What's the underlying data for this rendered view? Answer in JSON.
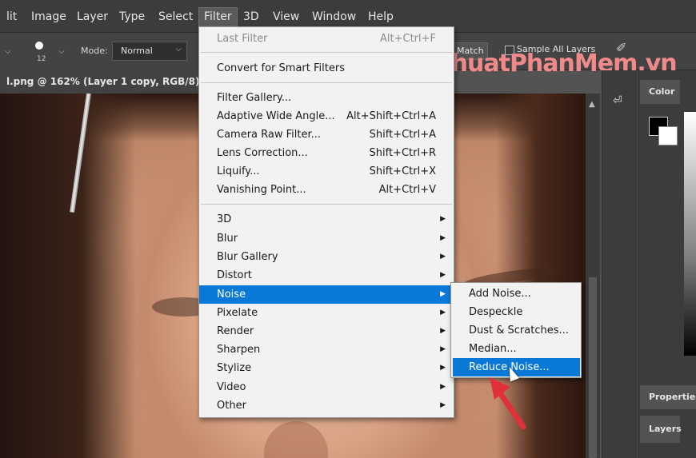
{
  "menubar": {
    "items": [
      "lit",
      "Image",
      "Layer",
      "Type",
      "Select",
      "Filter",
      "3D",
      "View",
      "Window",
      "Help"
    ],
    "active": "Filter"
  },
  "options_bar": {
    "brush_size": "12",
    "mode_label": "Mode:",
    "mode_value": "Normal",
    "match_label": "Match",
    "sample_all_layers_label": "Sample All Layers"
  },
  "document": {
    "tab_title": "l.png @ 162% (Layer 1 copy, RGB/8) *"
  },
  "watermark": "ThuThuatPhanMem.vn",
  "filter_menu": {
    "items": [
      {
        "label": "Last Filter",
        "shortcut": "Alt+Ctrl+F",
        "disabled": true
      },
      {
        "label": "Convert for Smart Filters",
        "shortcut": ""
      },
      {
        "label": "Filter Gallery...",
        "shortcut": ""
      },
      {
        "label": "Adaptive Wide Angle...",
        "shortcut": "Alt+Shift+Ctrl+A"
      },
      {
        "label": "Camera Raw Filter...",
        "shortcut": "Shift+Ctrl+A"
      },
      {
        "label": "Lens Correction...",
        "shortcut": "Shift+Ctrl+R"
      },
      {
        "label": "Liquify...",
        "shortcut": "Shift+Ctrl+X"
      },
      {
        "label": "Vanishing Point...",
        "shortcut": "Alt+Ctrl+V"
      },
      {
        "label": "3D",
        "submenu": true
      },
      {
        "label": "Blur",
        "submenu": true
      },
      {
        "label": "Blur Gallery",
        "submenu": true
      },
      {
        "label": "Distort",
        "submenu": true
      },
      {
        "label": "Noise",
        "submenu": true,
        "highlighted": true
      },
      {
        "label": "Pixelate",
        "submenu": true
      },
      {
        "label": "Render",
        "submenu": true
      },
      {
        "label": "Sharpen",
        "submenu": true
      },
      {
        "label": "Stylize",
        "submenu": true
      },
      {
        "label": "Video",
        "submenu": true
      },
      {
        "label": "Other",
        "submenu": true
      }
    ]
  },
  "noise_submenu": {
    "items": [
      {
        "label": "Add Noise..."
      },
      {
        "label": "Despeckle"
      },
      {
        "label": "Dust & Scratches..."
      },
      {
        "label": "Median..."
      },
      {
        "label": "Reduce Noise...",
        "highlighted": true
      }
    ]
  },
  "panels": {
    "color_tab": "Color",
    "properties_tab": "Properties",
    "layers_tab": "Layers"
  },
  "colors": {
    "menu_highlight": "#0a78d7",
    "arrow_red": "#e0313a",
    "foreground": "#000000",
    "background": "#ffffff"
  },
  "icons": {
    "submenu_arrow": "▶",
    "cursor": "arrow-cursor-icon"
  }
}
